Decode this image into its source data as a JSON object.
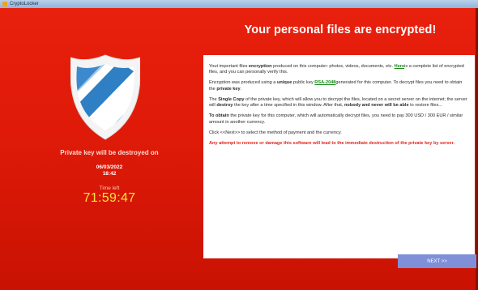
{
  "window": {
    "title": "CryptoLocker",
    "app_icon": "lock-app-icon"
  },
  "headline": "Your personal files are encrypted!",
  "shield": {
    "icon": "shield-icon",
    "colors": {
      "outer": "#f3f3f3",
      "blue": "#2d7fc7",
      "light": "#ffffff"
    }
  },
  "left_info": {
    "destroy_text": "Private key will be destroyed on",
    "date": "06/03/2022",
    "time": "18:42",
    "time_left_label": "Time left",
    "countdown": "71:59:47"
  },
  "panel": {
    "p1_a": "Yout important files ",
    "p1_b": "encryption",
    "p1_c": " produced on this computer: photos, videos, documents, etc. ",
    "p1_link": "Here",
    "p1_d": "is a complete list of encrypted files, and you can personally verify this.",
    "p2_a": "Encryption was produced using a ",
    "p2_b": "unique",
    "p2_c": " public key ",
    "p2_key": "RSA-2048",
    "p2_d": "generated for this computer. To decrypt files you need to obtain the ",
    "p2_e": "private key",
    "p2_f": ".",
    "p3_a": "The ",
    "p3_b": "Single Copy",
    "p3_c": " of the private key, which will allow you to decrypt the files, located on a secret server on the internet; the server will ",
    "p3_d": "destroy",
    "p3_e": " the key after a time specified in this window. After that, ",
    "p3_f": "nobody and never will be able",
    "p3_g": " to restore files...",
    "p4_a": "To obtain",
    "p4_b": " the private key for this computer, which will automatically decrypt files, you need to pay 300 USD / 300 EUR / similar amount in another currency.",
    "p5": "Click <<Next>> to select the method of payment and the currency.",
    "warning": "Any attempt to remove or damage this software will lead to the immediate destruction of the private key by server."
  },
  "next_button": {
    "label": "NEXT >>"
  },
  "colors": {
    "background": "#df1a08",
    "countdown": "#ffe13a",
    "link": "#1a8a1a",
    "warning": "#e0241b",
    "button": "#7f90d8"
  }
}
